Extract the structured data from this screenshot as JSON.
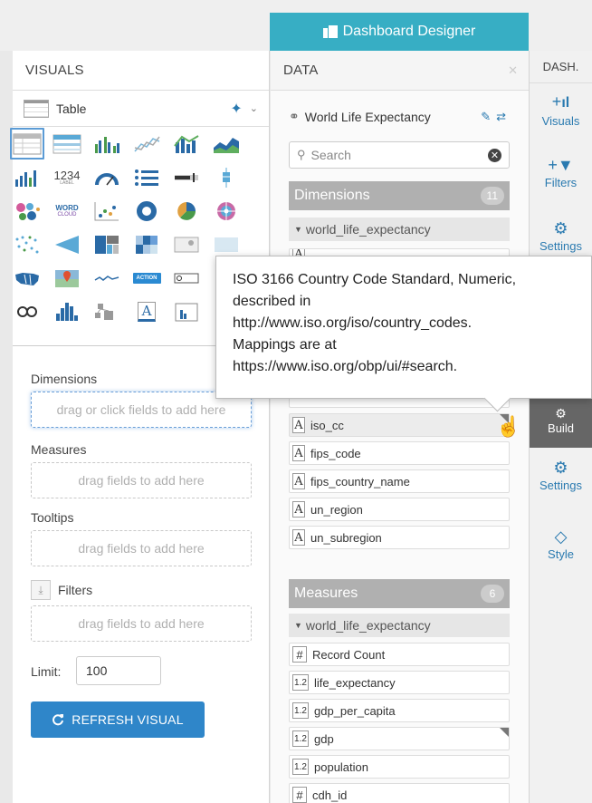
{
  "header": {
    "designer_tab": "Dashboard Designer"
  },
  "visuals": {
    "title": "VISUALS",
    "selected_type": "Table",
    "shelves": {
      "dimensions_label": "Dimensions",
      "dimensions_placeholder": "drag or click fields to add here",
      "measures_label": "Measures",
      "measures_placeholder": "drag fields to add here",
      "tooltips_label": "Tooltips",
      "tooltips_placeholder": "drag fields to add here",
      "filters_label": "Filters",
      "filters_placeholder": "drag fields to add here"
    },
    "limit_label": "Limit:",
    "limit_value": "100",
    "refresh_label": "REFRESH VISUAL",
    "grid_labels": {
      "kpi": "1234",
      "kpi_sub": "LABEL",
      "word": "WORD",
      "word_sub": "CLOUD",
      "action": "ACTION",
      "text": "A"
    }
  },
  "data_panel": {
    "title": "DATA",
    "dataset": "World Life Expectancy",
    "search_placeholder": "Search",
    "dimensions": {
      "label": "Dimensions",
      "count": "11",
      "table": "world_life_expectancy",
      "visible_fields": [
        "iso_cc",
        "fips_code",
        "fips_country_name",
        "un_region",
        "un_subregion"
      ]
    },
    "measures": {
      "label": "Measures",
      "count": "6",
      "table": "world_life_expectancy",
      "fields": [
        {
          "type": "#",
          "name": "Record Count"
        },
        {
          "type": "1.2",
          "name": "life_expectancy"
        },
        {
          "type": "1.2",
          "name": "gdp_per_capita"
        },
        {
          "type": "1.2",
          "name": "gdp"
        },
        {
          "type": "1.2",
          "name": "population"
        },
        {
          "type": "#",
          "name": "cdh_id"
        }
      ]
    },
    "field_type_text": "A"
  },
  "dash_panel": {
    "title": "DASH.",
    "buttons": [
      "Visuals",
      "Filters",
      "Settings"
    ],
    "build": "Build",
    "buttons_lower": [
      "Settings",
      "Style"
    ]
  },
  "tooltip": {
    "lines": [
      "ISO 3166 Country Code Standard, Numeric,",
      "described in",
      "http://www.iso.org/iso/country_codes.",
      "Mappings are at",
      "https://www.iso.org/obp/ui/#search."
    ]
  },
  "colors": {
    "accent": "#37aec4",
    "primary_button": "#2f86c9",
    "section_header": "#b0b0b0"
  }
}
